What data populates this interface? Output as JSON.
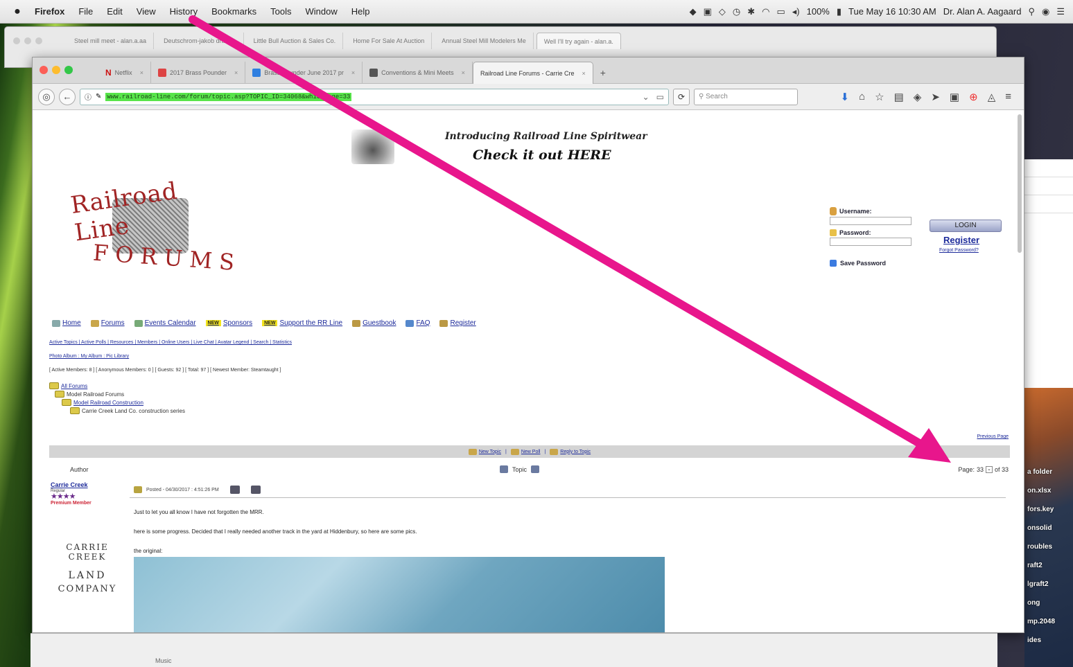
{
  "menubar": {
    "app": "Firefox",
    "items": [
      "File",
      "Edit",
      "View",
      "History",
      "Bookmarks",
      "Tools",
      "Window",
      "Help"
    ],
    "battery": "100%",
    "clock": "Tue May 16 10:30 AM",
    "user": "Dr. Alan A. Aagaard"
  },
  "back_window": {
    "tabs": [
      "Steel mill meet - alan.a.aa",
      "Deutschrom-jakob drawso",
      "Little Bull Auction & Sales Co.",
      "Home For Sale At Auction",
      "Annual Steel Mill Modelers Me",
      "Well I'll try again - alan.a."
    ]
  },
  "front_window": {
    "tabs": [
      {
        "label": "Netflix",
        "icon": "netflix-icon"
      },
      {
        "label": "2017 Brass Pounder",
        "icon": "gmail-icon"
      },
      {
        "label": "Brass Pounder June 2017 pr",
        "icon": "dropbox-icon"
      },
      {
        "label": "Conventions & Mini Meets",
        "icon": "conventions-icon"
      },
      {
        "label": "Railroad Line Forums - Carrie Cre",
        "icon": "forum-icon",
        "active": true
      }
    ],
    "url": "www.railroad-line.com/forum/topic.asp?TOPIC_ID=34068&whichpage=33",
    "search_placeholder": "Search"
  },
  "page": {
    "promo": {
      "line1": "Introducing Railroad Line Spiritwear",
      "line2": "Check it out HERE"
    },
    "logo": {
      "top": "Railroad Line",
      "bottom": "FORUMS"
    },
    "login": {
      "username_label": "Username:",
      "password_label": "Password:",
      "login_button": "LOGIN",
      "register": "Register",
      "forgot": "Forgot Password?",
      "save_password": "Save Password"
    },
    "nav": [
      {
        "label": "Home",
        "icon": "home-icon",
        "new": false
      },
      {
        "label": "Forums",
        "icon": "forums-icon",
        "new": false
      },
      {
        "label": "Events Calendar",
        "icon": "calendar-icon",
        "new": false
      },
      {
        "label": "Sponsors",
        "icon": "sponsors-icon",
        "new": true
      },
      {
        "label": "Support the RR Line",
        "icon": "support-icon",
        "new": true
      },
      {
        "label": "Guestbook",
        "icon": "guestbook-icon",
        "new": false
      },
      {
        "label": "FAQ",
        "icon": "faq-icon",
        "new": false
      },
      {
        "label": "Register",
        "icon": "register-icon",
        "new": false
      }
    ],
    "new_badge": "NEW",
    "sublinks1": "Active Topics | Active Polls | Resources | Members | Online Users | Live Chat | Avatar Legend | Search | Statistics",
    "sublinks2": "Photo Album : My Album : Pic Library",
    "stats": "[ Active Members: 8 ] [ Anonymous Members: 0 ] [ Guests: 92 ] [ Total: 97 ] [ Newest Member: Steamtaught ]",
    "tree": {
      "root": "All Forums",
      "level1": "Model Railroad Forums",
      "level2": "Model Railroad Construction",
      "level3": "Carrie Creek Land Co. construction series"
    },
    "previous_page": "Previous Page",
    "actions": [
      "New Topic",
      "New Poll",
      "Reply to Topic"
    ],
    "table": {
      "author_header": "Author",
      "topic_header": "Topic",
      "pages_label": "Page:",
      "current_page": "33",
      "total_pages": "of 33"
    },
    "post": {
      "author": "Carrie Creek",
      "author_role": "Regular",
      "stars": "★★★★",
      "rank": "Premium Member",
      "meta": "Posted - 04/30/2017 : 4:51:26 PM",
      "line1": "Just to let you all know I have not forgotten the MRR.",
      "line2": "here is some progress. Decided that I really needed another track in the yard at Hiddenbury, so here are some pics.",
      "line3": "the original:"
    },
    "company_logo": {
      "arc": "CARRIE CREEK",
      "mid": "LAND",
      "bot": "COMPANY"
    }
  },
  "desktop_labels": [
    "a folder",
    "on.xlsx",
    "fors.key",
    "onsolid",
    "roubles",
    "raft2",
    "lgraft2",
    "ong",
    "mp.2048",
    "ides"
  ],
  "bottom_window": {
    "text": "Music"
  },
  "annotation": {
    "color": "#e8168c"
  }
}
